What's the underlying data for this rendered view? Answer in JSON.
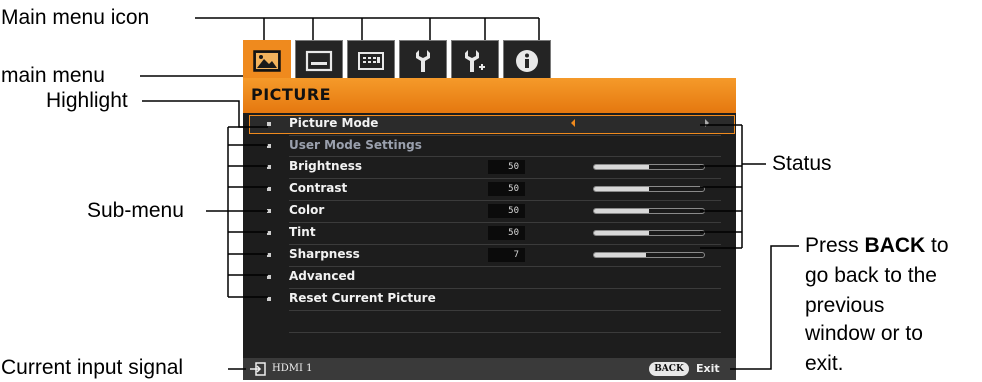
{
  "callouts": {
    "main_menu_icon": "Main menu icon",
    "main_menu": "main menu",
    "highlight": "Highlight",
    "sub_menu": "Sub-menu",
    "current_input_signal": "Current input signal",
    "status": "Status",
    "press": "Press",
    "back_bold": "BACK",
    "to": " to",
    "line2": "go back to the",
    "line3": "previous",
    "line4": "window or to",
    "line5": "exit."
  },
  "tabs": [
    {
      "icon": "picture-icon",
      "active": true
    },
    {
      "icon": "display-icon",
      "active": false
    },
    {
      "icon": "keypad-icon",
      "active": false
    },
    {
      "icon": "wrench-icon",
      "active": false
    },
    {
      "icon": "wrench-plus-icon",
      "active": false
    },
    {
      "icon": "info-icon",
      "active": false
    }
  ],
  "menu": {
    "title": "PICTURE",
    "items": [
      {
        "label": "Picture Mode",
        "type": "selector"
      },
      {
        "label": "User Mode Settings",
        "type": "dim"
      },
      {
        "label": "Brightness",
        "value": "50",
        "level": 0.5
      },
      {
        "label": "Contrast",
        "value": "50",
        "level": 0.5
      },
      {
        "label": "Color",
        "value": "50",
        "level": 0.5
      },
      {
        "label": "Tint",
        "value": "50",
        "level": 0.5
      },
      {
        "label": "Sharpness",
        "value": "7",
        "level": 0.47
      },
      {
        "label": "Advanced"
      },
      {
        "label": "Reset Current Picture"
      }
    ]
  },
  "footer": {
    "source": "HDMI 1",
    "back_button": "BACK",
    "exit": "Exit"
  },
  "colors": {
    "accent": "#ef8a1e",
    "osd_bg": "#1d1d1d",
    "footer_bg": "#3a3a3a"
  }
}
